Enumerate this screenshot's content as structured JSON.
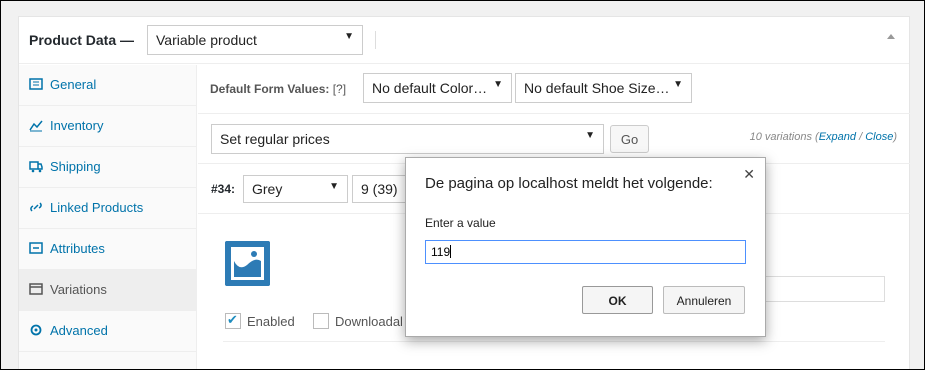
{
  "header": {
    "title": "Product Data —",
    "product_type": "Variable product"
  },
  "tabs": [
    {
      "label": "General",
      "icon": "general-icon"
    },
    {
      "label": "Inventory",
      "icon": "inventory-icon"
    },
    {
      "label": "Shipping",
      "icon": "shipping-icon"
    },
    {
      "label": "Linked Products",
      "icon": "link-icon"
    },
    {
      "label": "Attributes",
      "icon": "attributes-icon"
    },
    {
      "label": "Variations",
      "icon": "variations-icon"
    },
    {
      "label": "Advanced",
      "icon": "gear-icon"
    }
  ],
  "defaults": {
    "label": "Default Form Values:",
    "help": "[?]",
    "color": "No default Color…",
    "shoe_size": "No default Shoe Size…"
  },
  "bulk": {
    "action": "Set regular prices",
    "go": "Go",
    "count": "10 variations",
    "expand": "Expand",
    "slash": " / ",
    "close": "Close"
  },
  "variation": {
    "id": "#34:",
    "color": "Grey",
    "size": "9 (39)",
    "enabled_label": "Enabled",
    "downloadable_label": "Downloadal"
  },
  "dialog": {
    "title": "De pagina op localhost meldt het volgende:",
    "prompt": "Enter a value",
    "value": "119",
    "ok": "OK",
    "cancel": "Annuleren"
  },
  "colors": {
    "link": "#0073aa",
    "thumb": "#2d7bb5"
  }
}
